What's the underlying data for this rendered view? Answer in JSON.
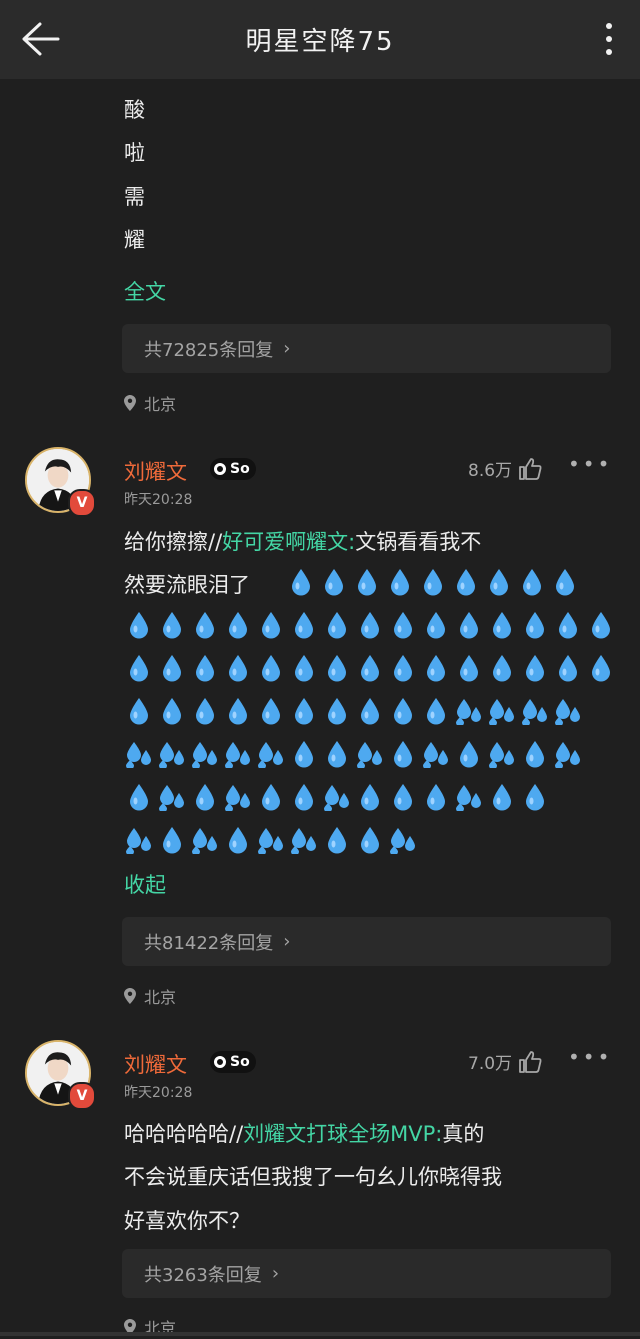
{
  "header": {
    "title": "明星空降75"
  },
  "post_tail": {
    "lines": [
      "酸",
      "啦",
      "需",
      "耀"
    ],
    "full_text_label": "全文",
    "replies": "共72825条回复",
    "location": "北京"
  },
  "comments": [
    {
      "username": "刘耀文",
      "badge": "So",
      "time": "昨天20:28",
      "likes": "8.6万",
      "text_prefix": "给你擦擦//",
      "mention": "好可爱啊耀文:",
      "text_rest": "文锅看看我不",
      "text_line2": "然要流眼泪了",
      "collapse_label": "收起",
      "replies": "共81422条回复",
      "location": "北京"
    },
    {
      "username": "刘耀文",
      "badge": "So",
      "time": "昨天20:28",
      "likes": "7.0万",
      "text_prefix": "哈哈哈哈哈//",
      "mention": "刘耀文打球全场MVP:",
      "text_rest": "真的",
      "text_line2": "不会说重庆话但我搜了一句幺儿你晓得我",
      "text_line3": "好喜欢你不？",
      "replies": "共3263条回复",
      "location": "北京"
    }
  ],
  "colors": {
    "accent_green": "#44d6a5",
    "username": "#ef6a3a",
    "drop_blue": "#4ea9f0"
  }
}
